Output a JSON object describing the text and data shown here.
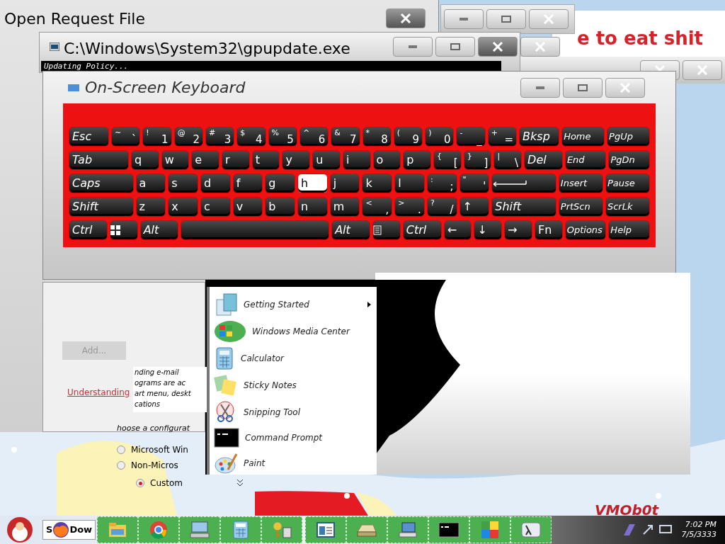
{
  "desktop": {
    "wallpaper_text": "VMOb0t"
  },
  "back_window": {
    "text": "e to eat shit"
  },
  "open_request_window": {
    "title": "Open Request File"
  },
  "gpupdate_window": {
    "title": "C:\\Windows\\System32\\gpupdate.exe",
    "console_text": "Updating Policy..."
  },
  "keyboard_window": {
    "title": "On-Screen Keyboard",
    "rows": [
      {
        "keys": [
          {
            "kind": "mod",
            "label": "Esc",
            "pressed": false
          },
          {
            "kind": "key",
            "shift": "~",
            "label": "`",
            "pressed": false
          },
          {
            "kind": "key",
            "shift": "!",
            "label": "1",
            "pressed": false
          },
          {
            "kind": "key",
            "shift": "@",
            "label": "2",
            "pressed": false
          },
          {
            "kind": "key",
            "shift": "#",
            "label": "3",
            "pressed": false
          },
          {
            "kind": "key",
            "shift": "$",
            "label": "4",
            "pressed": false
          },
          {
            "kind": "key",
            "shift": "%",
            "label": "5",
            "pressed": false
          },
          {
            "kind": "key",
            "shift": "^",
            "label": "6",
            "pressed": false
          },
          {
            "kind": "key",
            "shift": "&",
            "label": "7",
            "pressed": false
          },
          {
            "kind": "key",
            "shift": "*",
            "label": "8",
            "pressed": false
          },
          {
            "kind": "key",
            "shift": "(",
            "label": "9",
            "pressed": false
          },
          {
            "kind": "key",
            "shift": ")",
            "label": "0",
            "pressed": false
          },
          {
            "kind": "key",
            "shift": "-",
            "label": "_",
            "pressed": false
          },
          {
            "kind": "key",
            "shift": "+",
            "label": "=",
            "pressed": false
          },
          {
            "kind": "mod",
            "label": "Bksp",
            "pressed": false
          },
          {
            "kind": "nav",
            "label": "Home",
            "pressed": false
          },
          {
            "kind": "nav",
            "label": "PgUp",
            "pressed": false
          }
        ]
      },
      {
        "keys": [
          {
            "kind": "wide",
            "label": "Tab",
            "pressed": false
          },
          {
            "kind": "key",
            "label": "q",
            "pressed": false
          },
          {
            "kind": "key",
            "label": "w",
            "pressed": false
          },
          {
            "kind": "key",
            "label": "e",
            "pressed": false
          },
          {
            "kind": "key",
            "label": "r",
            "pressed": false
          },
          {
            "kind": "key",
            "label": "t",
            "pressed": false
          },
          {
            "kind": "key",
            "label": "y",
            "pressed": false
          },
          {
            "kind": "key",
            "label": "u",
            "pressed": false
          },
          {
            "kind": "key",
            "label": "i",
            "pressed": false
          },
          {
            "kind": "key",
            "label": "o",
            "pressed": false
          },
          {
            "kind": "key",
            "label": "p",
            "pressed": false
          },
          {
            "kind": "key",
            "shift": "{",
            "label": "[",
            "pressed": false
          },
          {
            "kind": "key",
            "shift": "}",
            "label": "]",
            "pressed": false
          },
          {
            "kind": "key",
            "shift": "|",
            "label": "\\",
            "pressed": false
          },
          {
            "kind": "mod",
            "label": "Del",
            "pressed": false
          },
          {
            "kind": "nav",
            "label": "End",
            "pressed": false
          },
          {
            "kind": "nav",
            "label": "PgDn",
            "pressed": false
          }
        ]
      },
      {
        "keys": [
          {
            "kind": "wide",
            "label": "Caps",
            "pressed": false
          },
          {
            "kind": "key",
            "label": "a",
            "pressed": false
          },
          {
            "kind": "key",
            "label": "s",
            "pressed": false
          },
          {
            "kind": "key",
            "label": "d",
            "pressed": false
          },
          {
            "kind": "key",
            "label": "f",
            "pressed": false
          },
          {
            "kind": "key",
            "label": "g",
            "pressed": false
          },
          {
            "kind": "key",
            "label": "h",
            "pressed": true
          },
          {
            "kind": "key",
            "label": "j",
            "pressed": false
          },
          {
            "kind": "key",
            "label": "k",
            "pressed": false
          },
          {
            "kind": "key",
            "label": "l",
            "pressed": false
          },
          {
            "kind": "key",
            "shift": ":",
            "label": ";",
            "pressed": false
          },
          {
            "kind": "key",
            "shift": "\"",
            "label": "'",
            "pressed": false
          },
          {
            "kind": "enter",
            "pressed": false
          },
          {
            "kind": "nav",
            "label": "Insert",
            "pressed": false
          },
          {
            "kind": "nav",
            "label": "Pause",
            "pressed": false
          }
        ]
      },
      {
        "keys": [
          {
            "kind": "wide",
            "label": "Shift",
            "pressed": false
          },
          {
            "kind": "key",
            "label": "z",
            "pressed": false
          },
          {
            "kind": "key",
            "label": "x",
            "pressed": false
          },
          {
            "kind": "key",
            "label": "c",
            "pressed": false
          },
          {
            "kind": "key",
            "label": "v",
            "pressed": false
          },
          {
            "kind": "key",
            "label": "b",
            "pressed": false
          },
          {
            "kind": "key",
            "label": "n",
            "pressed": false
          },
          {
            "kind": "key",
            "label": "m",
            "pressed": false
          },
          {
            "kind": "key",
            "shift": "<",
            "label": ",",
            "pressed": false
          },
          {
            "kind": "key",
            "shift": ">",
            "label": ".",
            "pressed": false
          },
          {
            "kind": "key",
            "shift": "?",
            "label": "/",
            "pressed": false
          },
          {
            "kind": "key",
            "label": "↑",
            "pressed": false
          },
          {
            "kind": "wide",
            "label": "Shift",
            "pressed": false
          },
          {
            "kind": "nav",
            "label": "PrtScn",
            "pressed": false
          },
          {
            "kind": "nav",
            "label": "ScrLk",
            "pressed": false
          }
        ]
      },
      {
        "keys": [
          {
            "kind": "mod",
            "label": "Ctrl",
            "pressed": false
          },
          {
            "kind": "windows",
            "pressed": false
          },
          {
            "kind": "mod",
            "label": "Alt",
            "pressed": false
          },
          {
            "kind": "space",
            "pressed": false
          },
          {
            "kind": "mod",
            "label": "Alt",
            "pressed": false
          },
          {
            "kind": "menu",
            "pressed": false
          },
          {
            "kind": "mod",
            "label": "Ctrl",
            "pressed": false
          },
          {
            "kind": "key",
            "label": "←",
            "pressed": false
          },
          {
            "kind": "key",
            "label": "↓",
            "pressed": false
          },
          {
            "kind": "key",
            "label": "→",
            "pressed": false
          },
          {
            "kind": "key",
            "label": "Fn",
            "pressed": false
          },
          {
            "kind": "nav",
            "label": "Options",
            "pressed": false
          },
          {
            "kind": "nav",
            "label": "Help",
            "pressed": false
          }
        ]
      }
    ]
  },
  "dialog": {
    "button": "Add...",
    "link": "Understanding",
    "text_lines": [
      "nding e-mail",
      "ograms are ac",
      "art menu, deskt",
      "cations"
    ],
    "heading": "hoose a configurat",
    "options": [
      {
        "label": "Microsoft Win",
        "selected": false
      },
      {
        "label": "Non-Micros",
        "selected": false
      },
      {
        "label": "Custom",
        "selected": true
      }
    ]
  },
  "start_menu": {
    "items": [
      {
        "kind": "getting-started",
        "label": "Getting Started",
        "submenu": true
      },
      {
        "kind": "media-center",
        "label": "Windows Media Center",
        "submenu": false
      },
      {
        "kind": "calculator",
        "label": "Calculator",
        "submenu": false
      },
      {
        "kind": "sticky-notes",
        "label": "Sticky Notes",
        "submenu": false
      },
      {
        "kind": "snipping",
        "label": "Snipping Tool",
        "submenu": false
      },
      {
        "kind": "cmd",
        "label": "Command Prompt",
        "submenu": false
      },
      {
        "kind": "paint",
        "label": "Paint",
        "submenu": false
      }
    ]
  },
  "taskbar": {
    "button_text": [
      "S",
      "Dow"
    ],
    "clock": {
      "time": "7:02 PM",
      "date": "7/5/3333"
    }
  }
}
